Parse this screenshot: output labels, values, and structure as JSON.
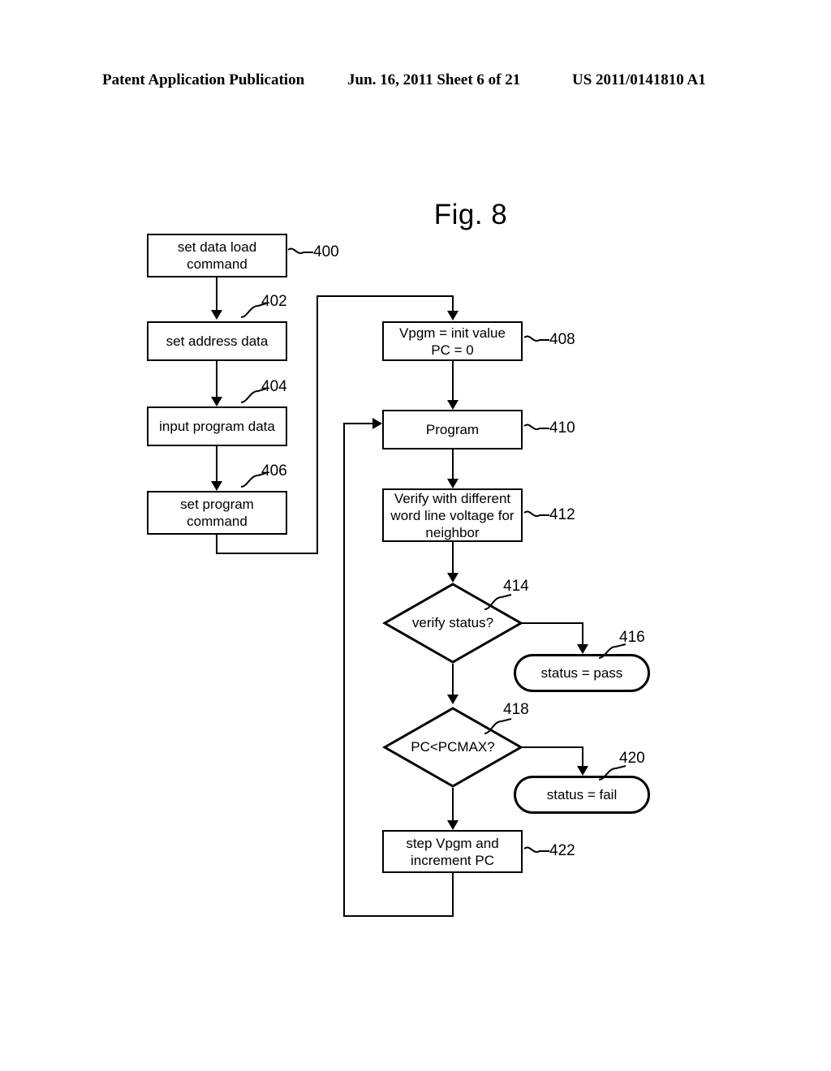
{
  "header": {
    "left": "Patent Application Publication",
    "middle": "Jun. 16, 2011  Sheet 6 of 21",
    "right": "US 2011/0141810 A1"
  },
  "figure": {
    "title": "Fig. 8",
    "nodes": {
      "n400": {
        "label": "set data load command",
        "ref": "400",
        "shape": "process"
      },
      "n402": {
        "label": "set address data",
        "ref": "402",
        "shape": "process"
      },
      "n404": {
        "label": "input program data",
        "ref": "404",
        "shape": "process"
      },
      "n406": {
        "label": "set program command",
        "ref": "406",
        "shape": "process"
      },
      "n408": {
        "label": "Vpgm = init value\nPC = 0",
        "line1": "Vpgm = init value",
        "line2": "PC = 0",
        "ref": "408",
        "shape": "process"
      },
      "n410": {
        "label": "Program",
        "ref": "410",
        "shape": "process"
      },
      "n412": {
        "label": "Verify with different word line voltage for neighbor",
        "line1": "Verify with different",
        "line2": "word line voltage for",
        "line3": "neighbor",
        "ref": "412",
        "shape": "process"
      },
      "n414": {
        "label": "verify status?",
        "ref": "414",
        "shape": "decision"
      },
      "n416": {
        "label": "status = pass",
        "ref": "416",
        "shape": "terminal"
      },
      "n418": {
        "label": "PC<PCMAX?",
        "ref": "418",
        "shape": "decision"
      },
      "n420": {
        "label": "status = fail",
        "ref": "420",
        "shape": "terminal"
      },
      "n422": {
        "label": "step Vpgm and increment PC",
        "line1": "step Vpgm and",
        "line2": "increment PC",
        "ref": "422",
        "shape": "process"
      }
    }
  }
}
